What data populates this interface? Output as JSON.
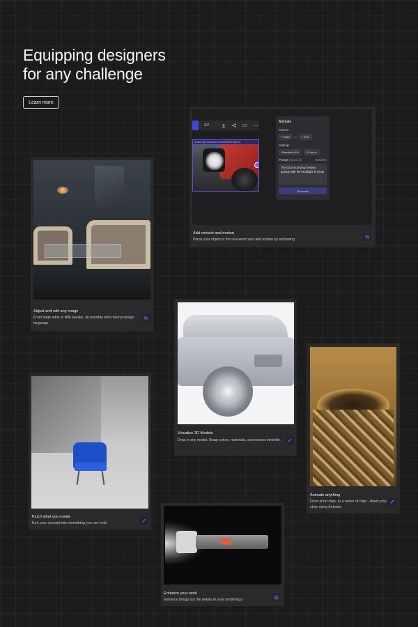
{
  "hero": {
    "title_line1": "Equipping designers",
    "title_line2": "for any challenge",
    "cta_label": "Learn more"
  },
  "cards": {
    "animate_ui": {
      "title": "Add content and motion",
      "desc": "Place your object in the real world and add motion by animating",
      "icon": "sliders-icon",
      "toolbar": {
        "ratio": "3:2"
      },
      "panel": {
        "title": "Animate",
        "frames_label": "Frames",
        "start_label": "Start",
        "end_label": "End",
        "settings_label": "Settings",
        "model_value": "Standard v2",
        "duration_value": "10 sec",
        "prompt_label": "Prompt",
        "prompt_optional": "(Optional)",
        "prompt_action": "Describe",
        "prompt_text": "The truck is driving forward quickly with the headlight in focus",
        "generate_label": "Generate"
      },
      "banner_text": "A black high-resolution commercial concept car"
    },
    "adjust": {
      "title": "Adjust and edit any image",
      "desc": "From large edits to little tweaks, all possible with natural design language",
      "icon": "sliders-icon"
    },
    "visualize": {
      "title": "Visualize 3D Models",
      "desc": "Drop in any model. Swap colors, materials, and scenes instantly.",
      "icon": "magic-wand-icon"
    },
    "animate_anything": {
      "title": "Animate anything",
      "desc": "From short clips, to a series of clips - direct your story using Animate",
      "icon": "magic-wand-icon"
    },
    "touch": {
      "title": "Touch what you create",
      "desc": "Turn your concept into something you can hold.",
      "icon": "magic-wand-icon"
    },
    "enhance": {
      "title": "Enhance your work",
      "desc": "Enhance brings out the details in your renderings",
      "icon": "enhance-icon"
    }
  },
  "colors": {
    "background": "#1c1c1c",
    "card": "#2a2a2c",
    "accent": "#4a43d8",
    "icon_bg": "#1e2433",
    "icon_fg": "#7d8fd6"
  }
}
